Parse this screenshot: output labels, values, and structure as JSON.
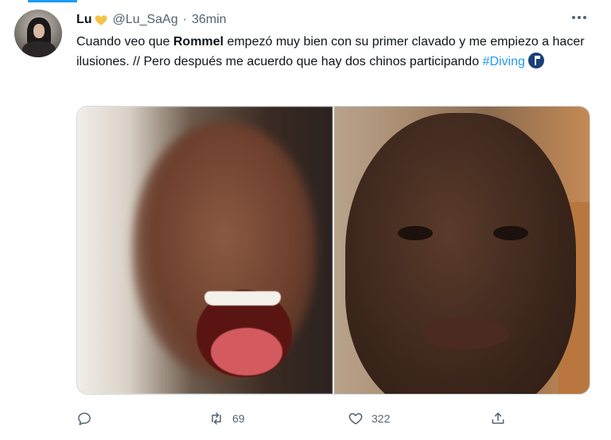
{
  "tweet": {
    "name": "Lu",
    "handle": "@Lu_SaAg",
    "separator": "·",
    "time": "36min",
    "text_part1": "Cuando veo que ",
    "text_bold": "Rommel",
    "text_part2": " empezó muy bien con su primer clavado y me empiezo a hacer ilusiones. // Pero después me acuerdo que hay dos chinos participando ",
    "hashtag": "#Diving",
    "icons": {
      "name_emoji": "yellow-heart-icon",
      "more": "more-icon",
      "hashflag": "diving-hashflag-icon"
    },
    "actions": {
      "reply_count": "",
      "retweet_count": "69",
      "like_count": "322",
      "share_count": ""
    },
    "colors": {
      "accent": "#1d9bf0",
      "secondary_text": "#536471",
      "text": "#0f1419"
    }
  }
}
